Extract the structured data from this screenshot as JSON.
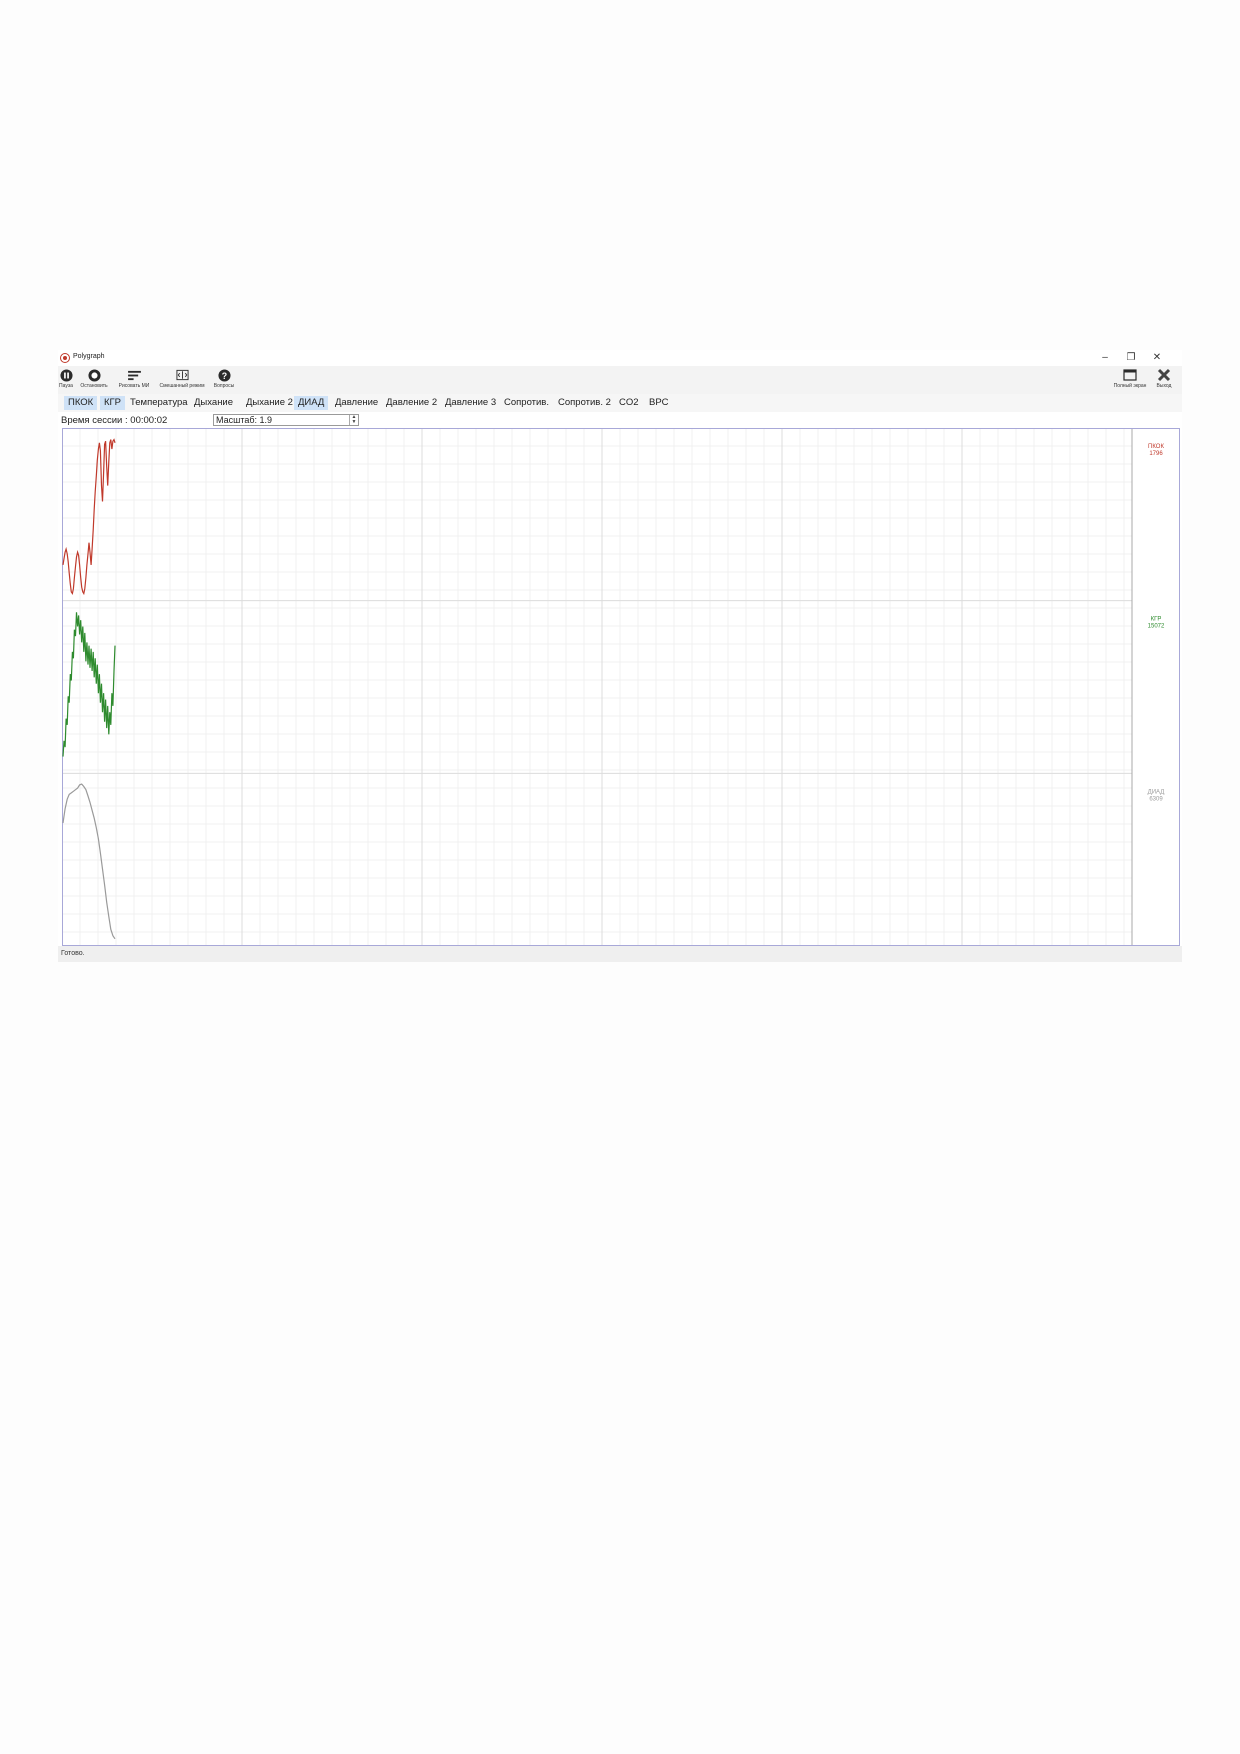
{
  "window": {
    "title": "Polygraph",
    "controls": {
      "minimize": "–",
      "restore": "❐",
      "close": "✕"
    }
  },
  "toolbar": {
    "left": [
      {
        "label": "Пауза",
        "icon": "pause-icon"
      },
      {
        "label": "Остановить",
        "icon": "stop-icon"
      },
      {
        "label": "Рисовать МИ",
        "icon": "draw-lines-icon"
      },
      {
        "label": "Смешанный режим",
        "icon": "mixed-mode-icon"
      },
      {
        "label": "Вопросы",
        "icon": "question-icon"
      }
    ],
    "right": [
      {
        "label": "Полный экран",
        "icon": "fullscreen-icon"
      },
      {
        "label": "Выход",
        "icon": "exit-icon"
      }
    ]
  },
  "tabs": [
    {
      "label": "ПКОК",
      "active": true
    },
    {
      "label": "КГР",
      "active": true
    },
    {
      "label": "Температура",
      "active": false
    },
    {
      "label": "Дыхание",
      "active": false
    },
    {
      "label": "Дыхание 2",
      "active": false
    },
    {
      "label": "ДИАД",
      "active": true
    },
    {
      "label": "Давление",
      "active": false
    },
    {
      "label": "Давление 2",
      "active": false
    },
    {
      "label": "Давление 3",
      "active": false
    },
    {
      "label": "Сопротив.",
      "active": false
    },
    {
      "label": "Сопротив. 2",
      "active": false
    },
    {
      "label": "CO2",
      "active": false
    },
    {
      "label": "ВРС",
      "active": false
    }
  ],
  "session": {
    "time_label": "Время сессии : 00:00:02",
    "scale_value": "Масштаб: 1.9"
  },
  "chart_data": {
    "type": "line",
    "grid": true,
    "legend_placement": "right",
    "series": [
      {
        "name": "ПКОК",
        "value_label": "1796",
        "color": "#c0392b",
        "x": [
          0,
          1,
          2,
          3,
          4,
          5,
          6,
          7,
          8,
          9,
          10,
          11,
          12,
          13,
          14,
          15,
          16,
          17,
          18,
          19,
          20,
          21,
          22,
          23,
          24,
          25,
          26,
          27,
          28,
          29,
          30,
          31,
          32,
          33,
          34,
          35,
          36,
          37,
          38,
          39,
          40,
          41,
          42,
          43,
          44,
          45,
          46,
          47,
          48,
          49,
          50
        ],
        "y": [
          0.2,
          0.24,
          0.28,
          0.3,
          0.27,
          0.22,
          0.15,
          0.08,
          0.03,
          0.02,
          0.05,
          0.12,
          0.19,
          0.25,
          0.28,
          0.26,
          0.2,
          0.12,
          0.06,
          0.03,
          0.02,
          0.05,
          0.12,
          0.2,
          0.27,
          0.34,
          0.28,
          0.2,
          0.3,
          0.42,
          0.55,
          0.66,
          0.76,
          0.86,
          0.93,
          0.97,
          0.92,
          0.7,
          0.6,
          0.78,
          0.96,
          0.98,
          0.82,
          0.7,
          0.85,
          0.97,
          0.99,
          0.93,
          0.98,
          0.99,
          0.97
        ]
      },
      {
        "name": "КГР",
        "value_label": "15072",
        "color": "#2e8b2e",
        "x": [
          0,
          1,
          2,
          3,
          4,
          5,
          6,
          7,
          8,
          9,
          10,
          11,
          12,
          13,
          14,
          15,
          16,
          17,
          18,
          19,
          20,
          21,
          22,
          23,
          24,
          25,
          26,
          27,
          28,
          29,
          30,
          31,
          32,
          33,
          34,
          35,
          36,
          37,
          38,
          39,
          40,
          41,
          42,
          43,
          44,
          45,
          46,
          47,
          48,
          49,
          50
        ],
        "y": [
          0.08,
          0.18,
          0.14,
          0.32,
          0.28,
          0.46,
          0.42,
          0.6,
          0.56,
          0.74,
          0.7,
          0.88,
          0.84,
          0.99,
          0.9,
          0.97,
          0.85,
          0.94,
          0.8,
          0.9,
          0.74,
          0.86,
          0.68,
          0.8,
          0.66,
          0.78,
          0.64,
          0.76,
          0.62,
          0.74,
          0.58,
          0.7,
          0.54,
          0.66,
          0.48,
          0.6,
          0.42,
          0.54,
          0.36,
          0.48,
          0.3,
          0.44,
          0.26,
          0.4,
          0.22,
          0.36,
          0.28,
          0.48,
          0.4,
          0.62,
          0.78
        ]
      },
      {
        "name": "ДИАД",
        "value_label": "6309",
        "color": "#9a9a9a",
        "x": [
          0,
          2,
          4,
          6,
          8,
          10,
          12,
          14,
          16,
          18,
          20,
          22,
          24,
          26,
          28,
          30,
          32,
          34,
          36,
          38,
          40,
          42,
          44,
          46,
          48,
          50
        ],
        "y": [
          0.75,
          0.84,
          0.9,
          0.93,
          0.94,
          0.95,
          0.96,
          0.97,
          0.99,
          0.995,
          0.98,
          0.96,
          0.92,
          0.88,
          0.83,
          0.78,
          0.72,
          0.65,
          0.56,
          0.46,
          0.36,
          0.25,
          0.16,
          0.08,
          0.04,
          0.02
        ]
      }
    ]
  },
  "status": {
    "text": "Готово."
  }
}
